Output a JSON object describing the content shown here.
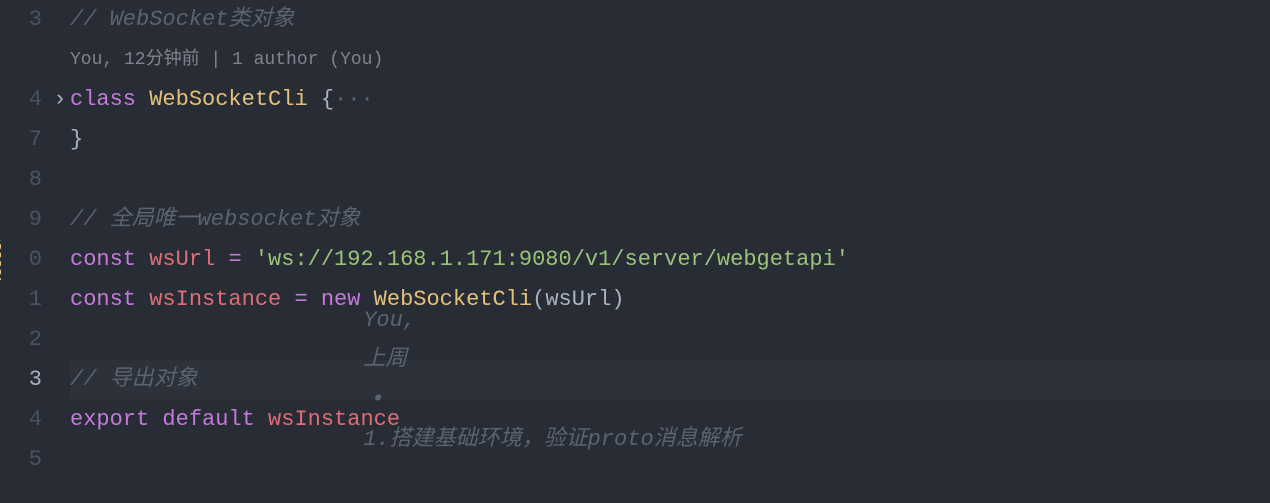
{
  "gutter": {
    "lines": [
      "3",
      "",
      "4",
      "7",
      "8",
      "9",
      "0",
      "1",
      "2",
      "3",
      "4",
      "5"
    ]
  },
  "fold": {
    "chevron": "›"
  },
  "codelens": {
    "text": "You, 12分钟前 | 1 author (You)"
  },
  "code": {
    "line3": {
      "comment": "// WebSocket类对象"
    },
    "line4": {
      "keyword": "class",
      "className": "WebSocketCli",
      "openBrace": "{",
      "fold": "···"
    },
    "line7": {
      "closeBrace": "}"
    },
    "line9": {
      "comment": "// 全局唯一websocket对象"
    },
    "line10": {
      "const": "const",
      "varName": "wsUrl",
      "equals": "=",
      "string": "'ws://192.168.1.171:9080/v1/server/webgetapi'"
    },
    "line11": {
      "const": "const",
      "varName": "wsInstance",
      "equals": "=",
      "newKw": "new",
      "className": "WebSocketCli",
      "openParen": "(",
      "arg": "wsUrl",
      "closeParen": ")"
    },
    "line13": {
      "comment": "// 导出对象"
    },
    "line14": {
      "export": "export",
      "default": "default",
      "varName": "wsInstance"
    }
  },
  "blame": {
    "author": "You,",
    "time": "上周",
    "dot": "•",
    "message": "1.搭建基础环境，验证proto消息解析"
  }
}
